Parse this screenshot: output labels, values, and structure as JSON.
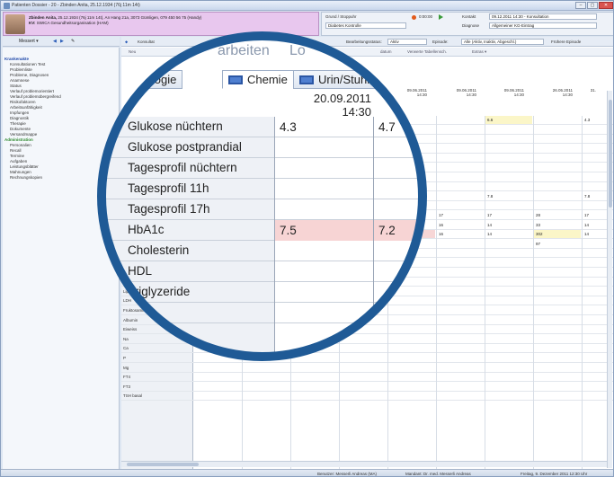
{
  "window": {
    "title": "Patienten Dossier - 20 - Zbinden Anita, 25.12.1934 (76j 11m 14t)",
    "controls": [
      "–",
      "▢",
      "✕"
    ]
  },
  "patient": {
    "name_line": "Zbinden Anita,",
    "name_detail": "25.12.1934 (76j 11m 14t), An Hang 21a, 3073 Gümligen, 079 450 56 75 (Handy)",
    "kv_label": "KV:",
    "kv_value": "SWICA Gesundheitsorganisation (HAM)"
  },
  "consult": {
    "grund_label": "Grund / Stoppuhr",
    "grund_value": "Diabetes Kontrolle",
    "timer": "0:00:00",
    "kontakt_label": "Kontakt",
    "kontakt_value": "09.12.2011 14:30 - Konsultation",
    "diagnose_label": "Diagnose",
    "diagnose_value": "Allgemeiner KG-Eintrag"
  },
  "left_toolbar": {
    "menu": "Messert ▾"
  },
  "case": {
    "label": "19.50 (Rechnung) / 133.10 (1. Mahnung)"
  },
  "tree": [
    {
      "label": "Krankenakte",
      "kind": "head"
    },
    {
      "label": "Konsultationen Test",
      "kind": "sub"
    },
    {
      "label": "Problemliste",
      "kind": "sub"
    },
    {
      "label": "Probleme, Diagnosen",
      "kind": "sub"
    },
    {
      "label": "Anamnese",
      "kind": "sub"
    },
    {
      "label": "Status",
      "kind": "sub"
    },
    {
      "label": "Verlauf problemorientiert",
      "kind": "sub"
    },
    {
      "label": "Verlauf problemübergreifend",
      "kind": "sub"
    },
    {
      "label": "Risikofaktoren",
      "kind": "sub"
    },
    {
      "label": "Arbeitsunfähigkeit",
      "kind": "sub"
    },
    {
      "label": "Impfungen",
      "kind": "sub"
    },
    {
      "label": "Diagnostik",
      "kind": "sub"
    },
    {
      "label": "Therapie",
      "kind": "sub"
    },
    {
      "label": "Dokumente",
      "kind": "sub"
    },
    {
      "label": "Versandmappe",
      "kind": "sub"
    },
    {
      "label": "Administration",
      "kind": "admin"
    },
    {
      "label": "Personalien",
      "kind": "sub"
    },
    {
      "label": "Recall",
      "kind": "sub"
    },
    {
      "label": "Termine",
      "kind": "sub"
    },
    {
      "label": "Aufgaben",
      "kind": "sub"
    },
    {
      "label": "Leistungsblätter",
      "kind": "sub"
    },
    {
      "label": "Mahnungen",
      "kind": "sub"
    },
    {
      "label": "Rechnungskopien",
      "kind": "sub"
    }
  ],
  "main_toolbar": {
    "kons": "Konsultat",
    "status_label": "Bearbeitungsstatus:",
    "status_value": "Aktiv",
    "episode_label": "Episode:",
    "episode_value": "Alle (Aktiv, Inaktiv, Abgeschl.)",
    "fruehere": "Frühere Episode"
  },
  "sub_toolbar": {
    "neu": "Neu",
    "datum": "datum",
    "verwerte": "Verwerte Tabellensch.",
    "extras": "Extras ▾"
  },
  "date_headers": [
    {
      "date": "09.06.2011",
      "time": "14:30"
    },
    {
      "date": "09.06.2011",
      "time": "14:30"
    },
    {
      "date": "09.06.2011",
      "time": "14:30"
    },
    {
      "date": "26.05.2011",
      "time": "14:30"
    },
    {
      "date": "31.",
      "time": ""
    }
  ],
  "grid_rows": [
    "",
    "",
    "",
    "",
    "",
    "",
    "",
    "",
    "",
    "",
    "",
    "GOT",
    "GPT",
    "γ-GT",
    "AP",
    "CK",
    "Amylase",
    "Pankreas Amylase",
    "Lipase",
    "LDH",
    "Fruktosamin",
    "Albumin",
    "Eiweiss",
    "Na",
    "Ca",
    "P",
    "Mg",
    "FT4",
    "FT3",
    "TSH basal"
  ],
  "grid_values": {
    "row0": [
      "6.6",
      "4.3"
    ],
    "ldl": [
      "7.8",
      "7.8"
    ],
    "got": [
      "17",
      "17",
      "28",
      "17"
    ],
    "gpt": [
      "16",
      "14",
      "33",
      "14"
    ],
    "ygt": [
      "285",
      "16",
      "14",
      "302",
      "14"
    ],
    "ap": [
      "95",
      "97"
    ]
  },
  "zoom": {
    "header_ghost_1": "arbeiten",
    "header_ghost_2": "Lo",
    "tabs": [
      "matologie",
      "Chemie",
      "Urin/Stuhl"
    ],
    "date": "20.09.2011",
    "time": "14:30",
    "rows": [
      {
        "label": "Glukose nüchtern",
        "v1": "4.3",
        "v2": "4.7",
        "pink": false
      },
      {
        "label": "Glukose postprandial",
        "v1": "",
        "v2": "",
        "pink": false
      },
      {
        "label": "Tagesprofil nüchtern",
        "v1": "",
        "v2": "",
        "pink": false
      },
      {
        "label": "Tagesprofil 11h",
        "v1": "",
        "v2": "",
        "pink": false
      },
      {
        "label": "Tagesprofil 17h",
        "v1": "",
        "v2": "",
        "pink": false
      },
      {
        "label": "HbA1c",
        "v1": "7.5",
        "v2": "7.2",
        "pink": true
      },
      {
        "label": "Cholesterin",
        "v1": "",
        "v2": "",
        "pink": false
      },
      {
        "label": "HDL",
        "v1": "",
        "v2": "",
        "pink": false
      },
      {
        "label": "Triglyzeride",
        "v1": "",
        "v2": "",
        "pink": false
      },
      {
        "label": "LDL",
        "v1": "",
        "v2": "",
        "pink": false
      }
    ]
  },
  "status": {
    "user": "Benutzer: Messerli Andreas  (MA)",
    "mandant": "Mandant: Dr. med. Messerli Andreas",
    "datetime": "Freitag, 9. Dezember 2011 12:30 Uhr"
  },
  "colors": {
    "lens_ring": "#1f5a96",
    "patient_bg": "#e8c7ee",
    "pink_cell": "#f7d4d4",
    "yellow_cell": "#fbf6c8",
    "admin_green": "#2f8a2f",
    "head_blue": "#1a44a8"
  }
}
